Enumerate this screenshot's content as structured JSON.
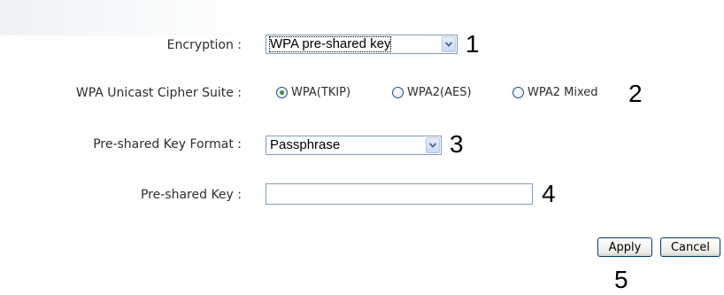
{
  "form": {
    "encryption": {
      "label": "Encryption :",
      "selected": "WPA pre-shared key",
      "callout": "1"
    },
    "cipher_suite": {
      "label": "WPA Unicast Cipher Suite :",
      "options": [
        {
          "label": "WPA(TKIP)",
          "checked": true
        },
        {
          "label": "WPA2(AES)",
          "checked": false
        },
        {
          "label": "WPA2 Mixed",
          "checked": false
        }
      ],
      "callout": "2"
    },
    "key_format": {
      "label": "Pre-shared Key Format :",
      "selected": "Passphrase",
      "callout": "3"
    },
    "psk": {
      "label": "Pre-shared Key :",
      "value": "",
      "callout": "4"
    }
  },
  "buttons": {
    "apply_label": "Apply",
    "cancel_label": "Cancel",
    "callout": "5"
  },
  "icons": {
    "dropdown": "chevron-down-icon",
    "radio": "radio-button-icon"
  },
  "colors": {
    "input_border": "#7f9db9",
    "radio_dot": "#2e9b2e",
    "button_border": "#003c74"
  }
}
